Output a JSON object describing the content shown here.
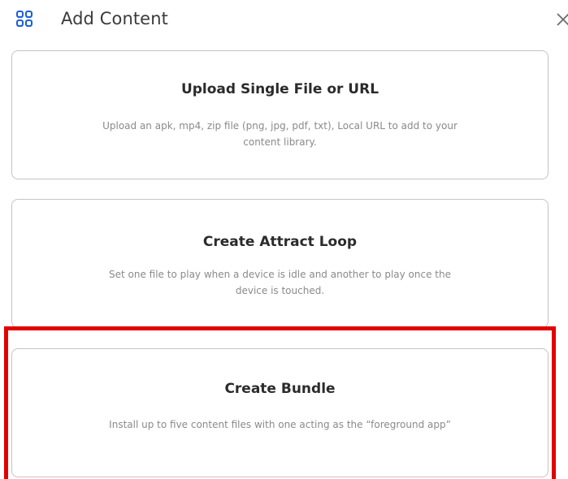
{
  "header": {
    "title": "Add Content",
    "icon": "grid-icon",
    "close_icon": "close-icon",
    "accent_color": "#1a5fd6"
  },
  "options": [
    {
      "title": "Upload Single File or URL",
      "description": "Upload an apk, mp4, zip file (png, jpg, pdf, txt), Local URL to add to your content library."
    },
    {
      "title": "Create Attract Loop",
      "description": "Set one file to play when a device is idle and another to play once the device is touched."
    },
    {
      "title": "Create Bundle",
      "description": "Install up to five content files with one acting as the “foreground app”"
    }
  ],
  "highlight_color": "#e30000"
}
